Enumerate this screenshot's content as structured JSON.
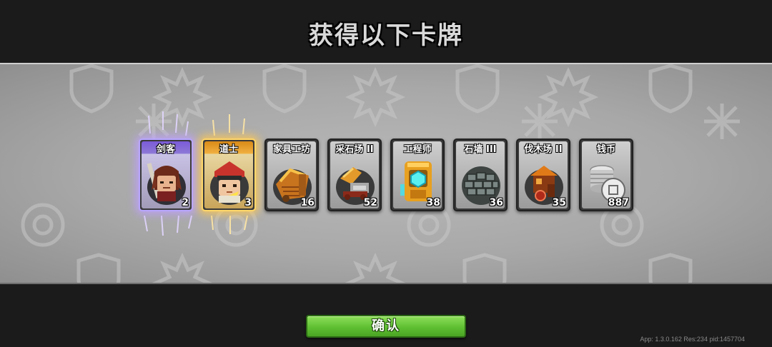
{
  "screen": {
    "title": "获得以下卡牌",
    "confirm_label": "确认",
    "version_text": "App: 1.3.0.162 Res:234 pid:1457704"
  },
  "cards": [
    {
      "name": "剑客",
      "count": "2",
      "rarity": "purple",
      "icon": "swordsman-portrait"
    },
    {
      "name": "道士",
      "count": "3",
      "rarity": "gold",
      "icon": "taoist-portrait"
    },
    {
      "name": "家具工坊",
      "count": "16",
      "rarity": "normal",
      "icon": "furniture-workshop"
    },
    {
      "name": "采石场 II",
      "count": "52",
      "rarity": "normal",
      "icon": "quarry"
    },
    {
      "name": "工程师",
      "count": "38",
      "rarity": "normal",
      "icon": "engineer-robot"
    },
    {
      "name": "石墙 III",
      "count": "36",
      "rarity": "normal",
      "icon": "stone-wall"
    },
    {
      "name": "伐木场 II",
      "count": "35",
      "rarity": "normal",
      "icon": "lumber-mill"
    },
    {
      "name": "钱币",
      "count": "887",
      "rarity": "normal",
      "icon": "coin-stack"
    }
  ],
  "colors": {
    "purple_rarity": "#b8a6ff",
    "gold_rarity": "#ffd76a",
    "confirm_green": "#5fbf33"
  }
}
